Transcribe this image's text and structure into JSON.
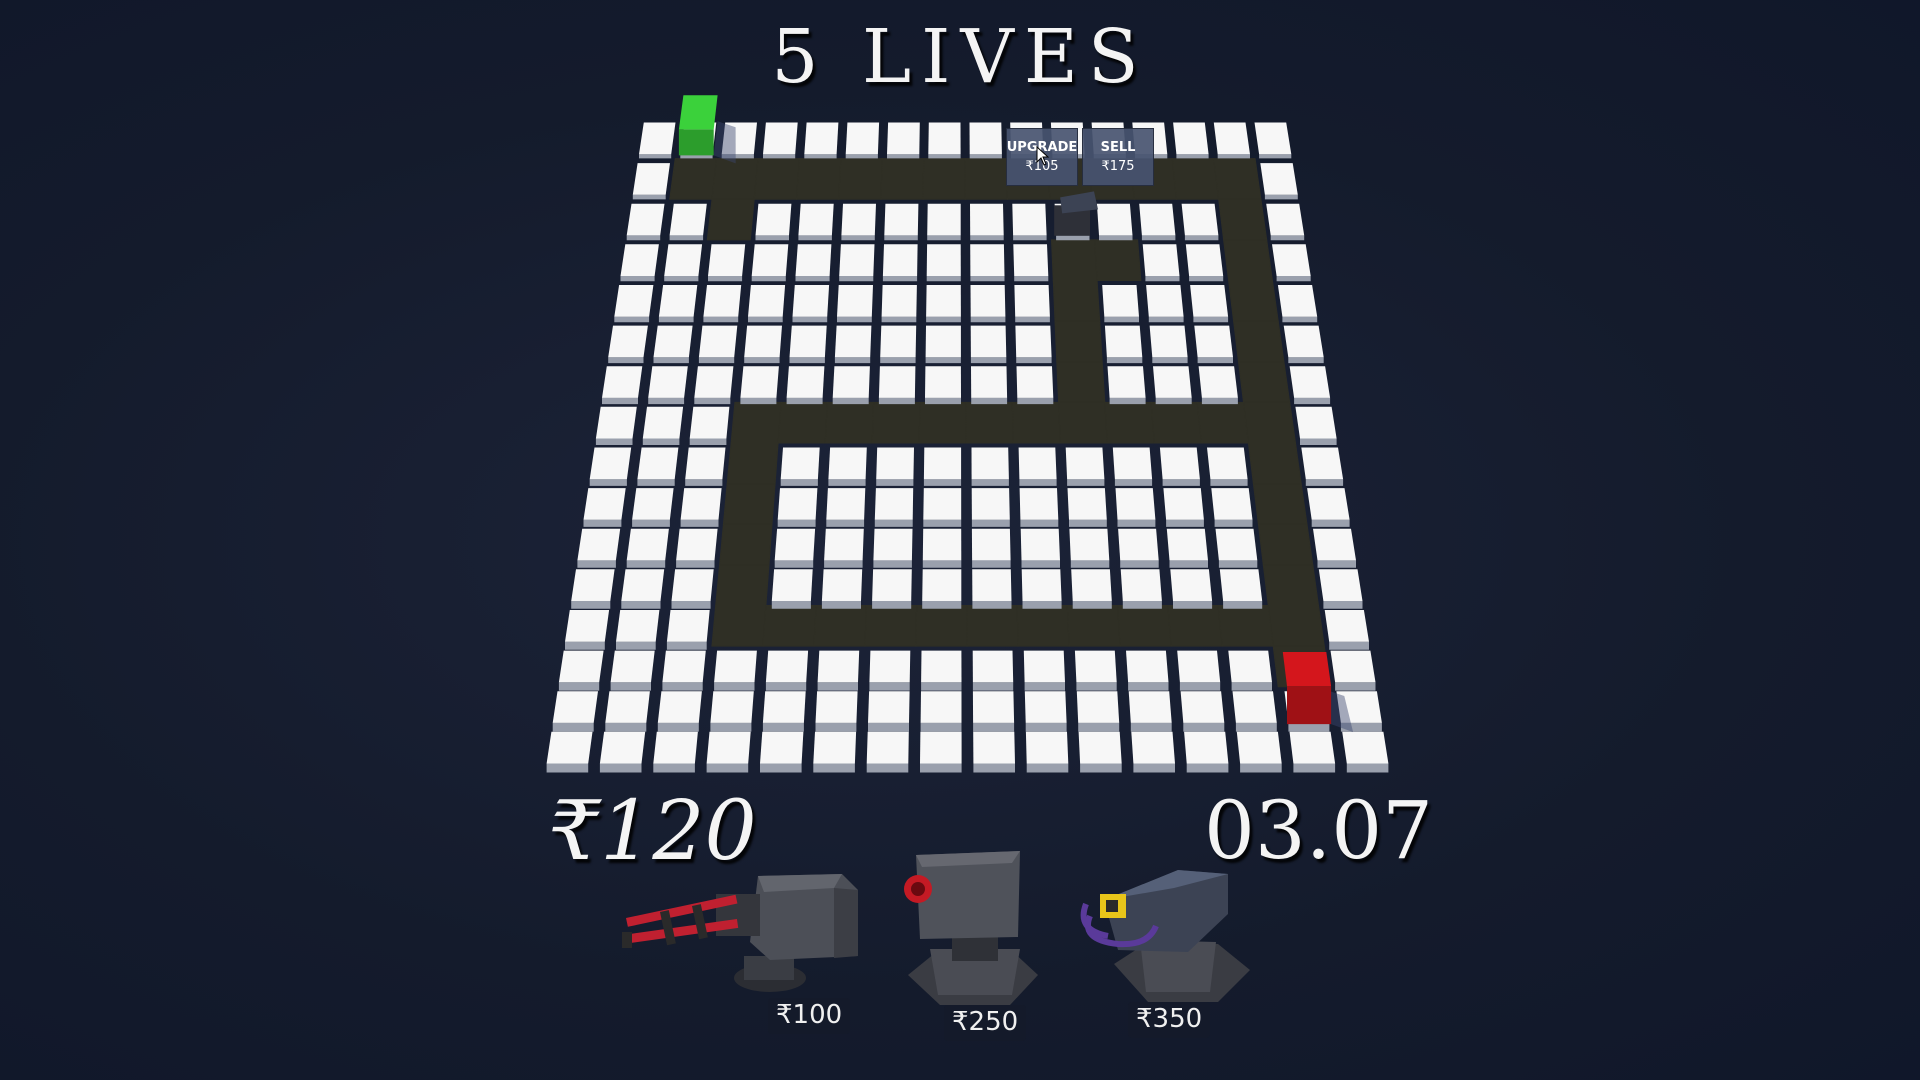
{
  "hud": {
    "lives": "5 LIVES",
    "money": "₹120",
    "timer": "03.07"
  },
  "tower_popup": {
    "upgrade_label": "UPGRADE",
    "upgrade_price": "₹105",
    "sell_label": "SELL",
    "sell_price": "₹175"
  },
  "shop": {
    "items": [
      {
        "name": "gatling-tower",
        "price": "₹100"
      },
      {
        "name": "cannon-tower",
        "price": "₹250"
      },
      {
        "name": "laser-tower",
        "price": "₹350"
      }
    ]
  },
  "board": {
    "columns": 16,
    "rows": 16,
    "path_color": "#2f2f25",
    "tile_color": "#f7f7f7",
    "spawn_color": "#3bd13b",
    "goal_color": "#d4161c",
    "path_cells": [
      [
        1,
        1
      ],
      [
        2,
        1
      ],
      [
        3,
        1
      ],
      [
        4,
        1
      ],
      [
        5,
        1
      ],
      [
        6,
        1
      ],
      [
        7,
        1
      ],
      [
        8,
        1
      ],
      [
        9,
        1
      ],
      [
        10,
        1
      ],
      [
        11,
        1
      ],
      [
        12,
        1
      ],
      [
        13,
        1
      ],
      [
        14,
        1
      ],
      [
        2,
        2
      ],
      [
        14,
        2
      ],
      [
        14,
        3
      ],
      [
        14,
        4
      ],
      [
        14,
        5
      ],
      [
        14,
        6
      ],
      [
        14,
        7
      ],
      [
        14,
        8
      ],
      [
        14,
        9
      ],
      [
        14,
        10
      ],
      [
        14,
        11
      ],
      [
        14,
        12
      ],
      [
        14,
        13
      ],
      [
        10,
        3
      ],
      [
        11,
        3
      ],
      [
        10,
        4
      ],
      [
        10,
        5
      ],
      [
        10,
        6
      ],
      [
        3,
        7
      ],
      [
        4,
        7
      ],
      [
        5,
        7
      ],
      [
        6,
        7
      ],
      [
        7,
        7
      ],
      [
        8,
        7
      ],
      [
        9,
        7
      ],
      [
        10,
        7
      ],
      [
        11,
        7
      ],
      [
        12,
        7
      ],
      [
        13,
        7
      ],
      [
        3,
        8
      ],
      [
        3,
        9
      ],
      [
        3,
        10
      ],
      [
        3,
        11
      ],
      [
        3,
        12
      ],
      [
        4,
        12
      ],
      [
        5,
        12
      ],
      [
        6,
        12
      ],
      [
        7,
        12
      ],
      [
        8,
        12
      ],
      [
        9,
        12
      ],
      [
        10,
        12
      ],
      [
        11,
        12
      ],
      [
        12,
        12
      ],
      [
        13,
        12
      ]
    ],
    "spawn_cell": [
      1,
      0
    ],
    "goal_cell": [
      14,
      14
    ],
    "placed_tower_cell": [
      10,
      2
    ]
  }
}
